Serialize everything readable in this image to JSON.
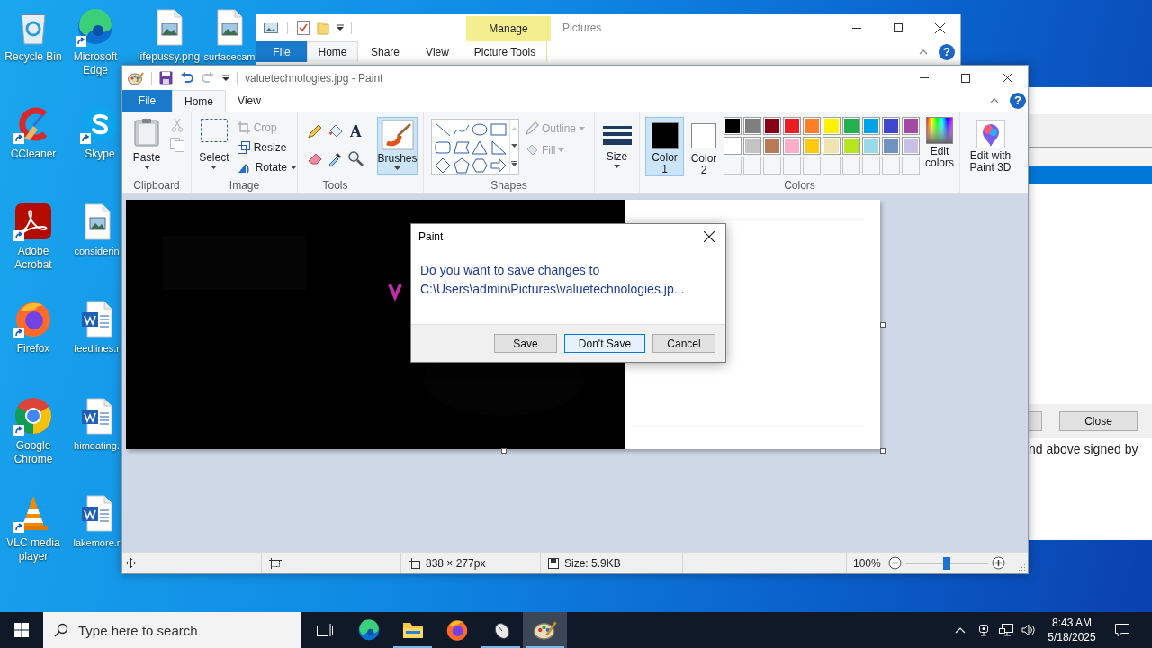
{
  "desktop_icons": [
    {
      "label": "Recycle Bin",
      "kind": "recycle_bin",
      "shortcut": false
    },
    {
      "label": "Microsoft Edge",
      "kind": "edge",
      "shortcut": true
    },
    {
      "label": "lifepussy.png",
      "kind": "image_file",
      "shortcut": false
    },
    {
      "label": "surfacecam",
      "kind": "image_file",
      "shortcut": false
    },
    {
      "label": "CCleaner",
      "kind": "ccleaner",
      "shortcut": true
    },
    {
      "label": "Skype",
      "kind": "skype",
      "shortcut": true
    },
    {
      "label": "Adobe Acrobat",
      "kind": "acrobat",
      "shortcut": true
    },
    {
      "label": "considerin",
      "kind": "image_file",
      "shortcut": false
    },
    {
      "label": "Firefox",
      "kind": "firefox",
      "shortcut": true
    },
    {
      "label": "feedlines.r",
      "kind": "word_file",
      "shortcut": false
    },
    {
      "label": "Google Chrome",
      "kind": "chrome",
      "shortcut": true
    },
    {
      "label": "himdating.",
      "kind": "word_file",
      "shortcut": false
    },
    {
      "label": "VLC media player",
      "kind": "vlc",
      "shortcut": true
    },
    {
      "label": "lakemore.r",
      "kind": "word_file",
      "shortcut": false
    }
  ],
  "explorer": {
    "context_group": "Manage",
    "title": "Pictures",
    "help": "?",
    "tabs": [
      {
        "label": "File",
        "kind": "file",
        "selected": false
      },
      {
        "label": "Home",
        "kind": "normal",
        "selected": true
      },
      {
        "label": "Share",
        "kind": "normal",
        "selected": false
      },
      {
        "label": "View",
        "kind": "normal",
        "selected": false
      },
      {
        "label": "Picture Tools",
        "kind": "context",
        "selected": false
      }
    ]
  },
  "paint": {
    "title": "valuetechnologies.jpg - Paint",
    "help": "?",
    "tabs": [
      {
        "label": "File",
        "kind": "file",
        "selected": false
      },
      {
        "label": "Home",
        "kind": "normal",
        "selected": true
      },
      {
        "label": "View",
        "kind": "normal",
        "selected": false
      }
    ],
    "clipboard": {
      "paste": "Paste",
      "cut_disabled": true,
      "copy_disabled": true,
      "group": "Clipboard"
    },
    "image": {
      "select": "Select",
      "group": "Image",
      "actions": [
        {
          "label": "Crop",
          "disabled": true,
          "dropdown": false
        },
        {
          "label": "Resize",
          "disabled": false,
          "dropdown": false
        },
        {
          "label": "Rotate",
          "disabled": false,
          "dropdown": true
        }
      ]
    },
    "tools": {
      "text_glyph": "A",
      "group": "Tools"
    },
    "brushes": {
      "label": "Brushes",
      "selected": true
    },
    "shapes": {
      "group": "Shapes",
      "options": [
        {
          "label": "Outline",
          "disabled": true
        },
        {
          "label": "Fill",
          "disabled": true
        }
      ]
    },
    "size": {
      "label": "Size"
    },
    "colors": {
      "group": "Colors",
      "edit": "Edit colors",
      "slots": [
        {
          "label": "Color 1",
          "color": "#000000",
          "selected": true
        },
        {
          "label": "Color 2",
          "color": "#ffffff",
          "selected": false
        }
      ],
      "palette": [
        {
          "color": "#000000"
        },
        {
          "color": "#7f7f7f"
        },
        {
          "color": "#880015"
        },
        {
          "color": "#ed1c24"
        },
        {
          "color": "#ff7f27"
        },
        {
          "color": "#fff200"
        },
        {
          "color": "#22b14c"
        },
        {
          "color": "#00a2e8"
        },
        {
          "color": "#3f48cc"
        },
        {
          "color": "#a349a4"
        },
        {
          "color": "#ffffff"
        },
        {
          "color": "#c3c3c3"
        },
        {
          "color": "#b97a57"
        },
        {
          "color": "#ffaec9"
        },
        {
          "color": "#ffc90e"
        },
        {
          "color": "#efe4b0"
        },
        {
          "color": "#b5e61d"
        },
        {
          "color": "#99d9ea"
        },
        {
          "color": "#7092be"
        },
        {
          "color": "#c8bfe7"
        }
      ]
    },
    "paint3d": {
      "label": "Edit with Paint 3D"
    },
    "status": {
      "dimensions": "838 × 277px",
      "size": "Size: 5.9KB",
      "zoom": "100%",
      "zoom_level": {
        "level": 0.5
      }
    }
  },
  "dialog": {
    "title": "Paint",
    "message_lines": [
      "Do you want to save changes to",
      "C:\\Users\\admin\\Pictures\\valuetechnologies.jp..."
    ],
    "buttons": [
      {
        "label": "Save",
        "selected": false
      },
      {
        "label": "Don't Save",
        "selected": true
      },
      {
        "label": "Cancel",
        "selected": false
      }
    ]
  },
  "background_window": {
    "button": "Close",
    "text": "nd above signed by"
  },
  "taskbar": {
    "search_placeholder": "Type here to search",
    "time": "8:43 AM",
    "date": "5/18/2025",
    "apps": [
      {
        "kind": "task_view",
        "running": false,
        "selected": false
      },
      {
        "kind": "edge",
        "running": false,
        "selected": false
      },
      {
        "kind": "explorer",
        "running": true,
        "selected": false
      },
      {
        "kind": "firefox",
        "running": false,
        "selected": false
      },
      {
        "kind": "mouse_app",
        "running": true,
        "selected": false
      },
      {
        "kind": "paint",
        "running": true,
        "selected": true
      }
    ]
  }
}
